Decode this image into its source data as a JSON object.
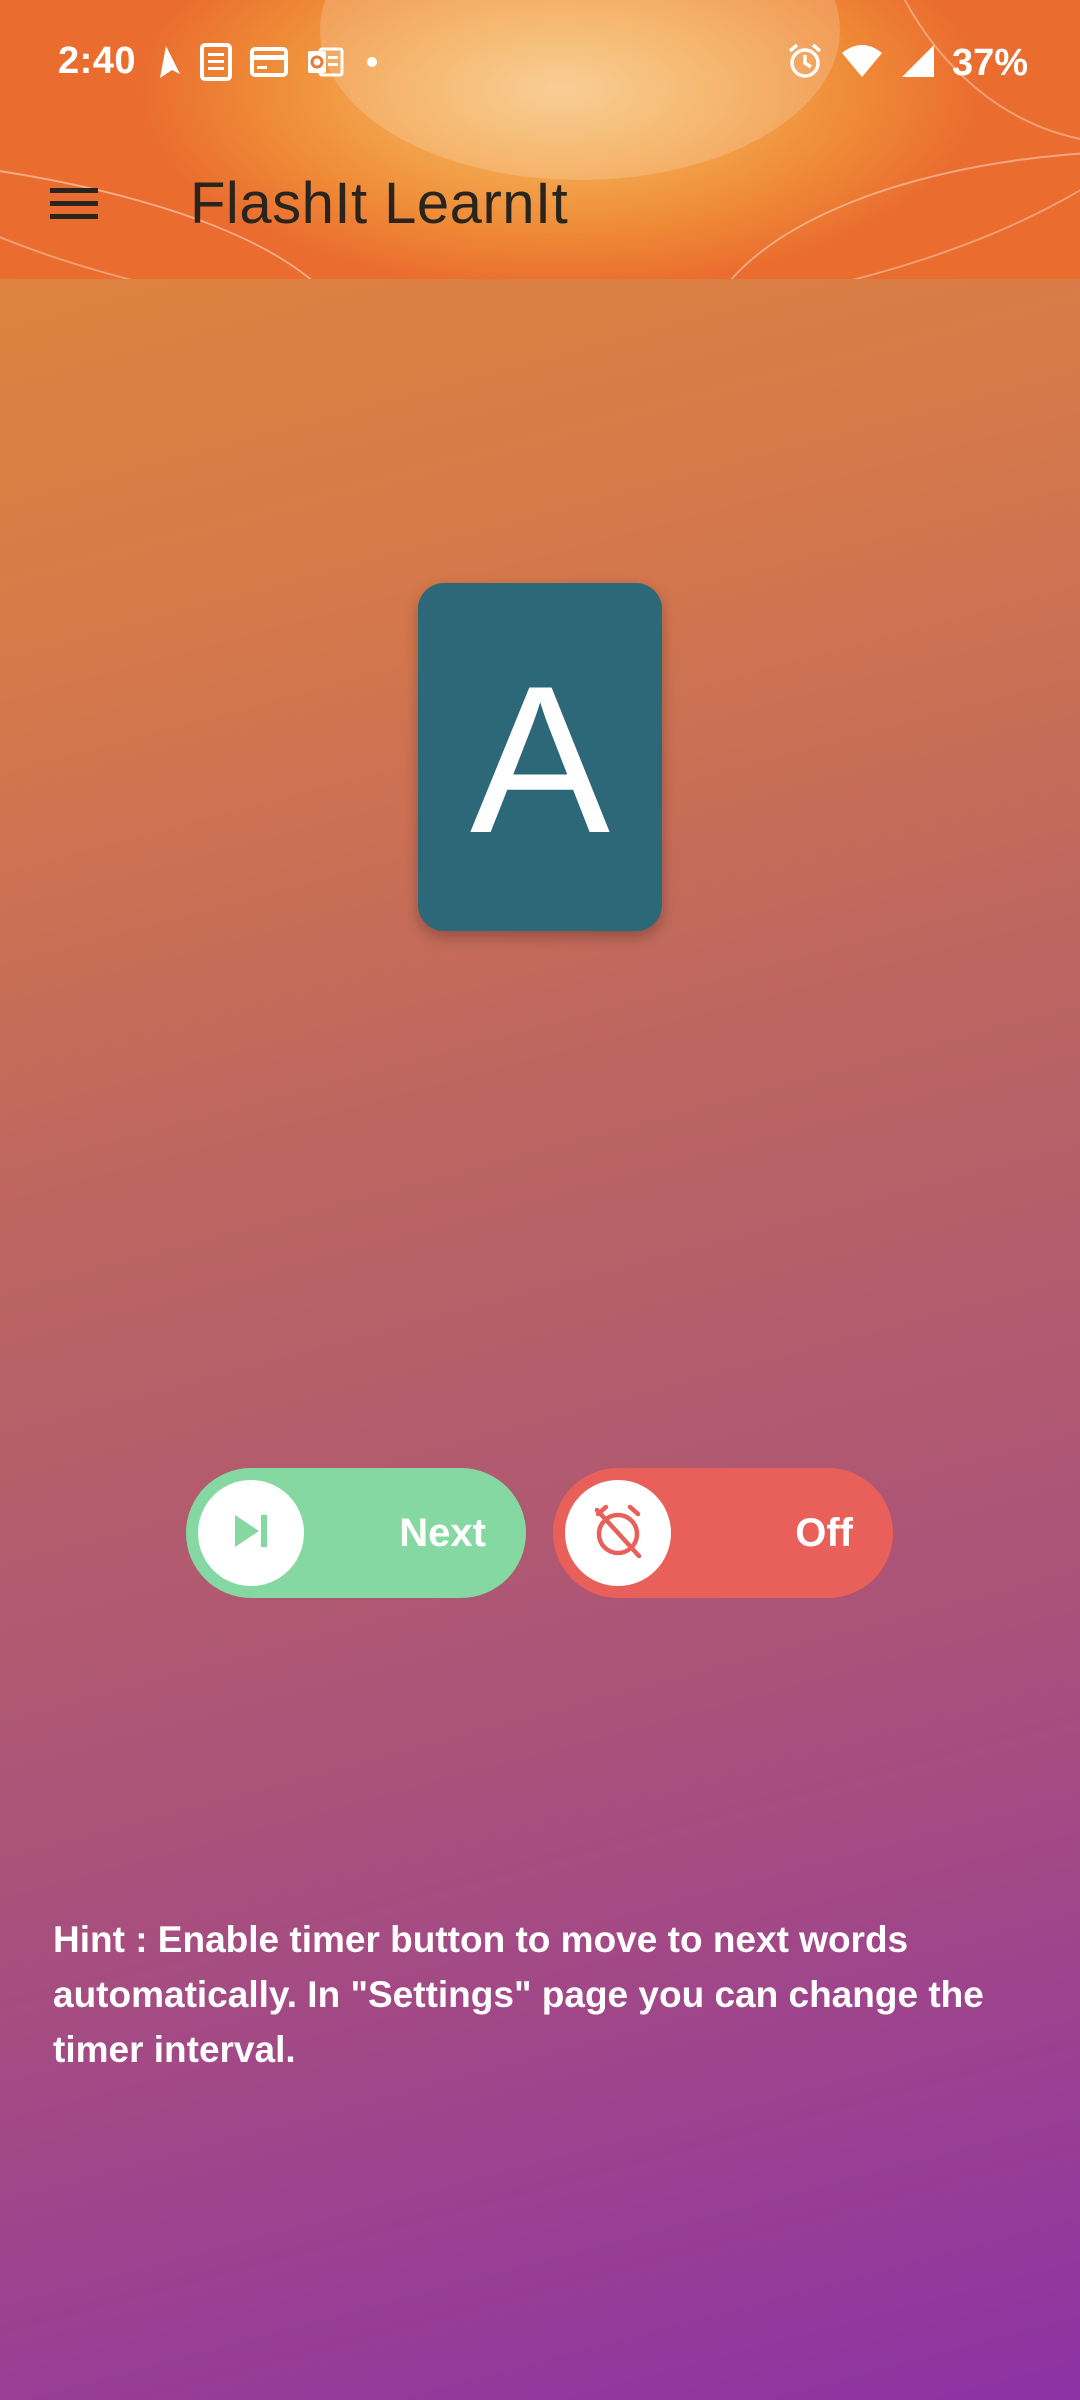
{
  "status_bar": {
    "time": "2:40",
    "battery": "37%",
    "left_icons": [
      "navigation-icon",
      "document-icon",
      "card-icon",
      "outlook-icon",
      "dot-icon"
    ],
    "right_icons": [
      "alarm-icon",
      "wifi-icon",
      "signal-icon"
    ]
  },
  "app_bar": {
    "title": "FlashIt LearnIt",
    "menu_icon": "menu-icon"
  },
  "flashcard": {
    "text": "A",
    "color": "#2d6878"
  },
  "controls": {
    "next": {
      "label": "Next",
      "icon": "skip-next-icon",
      "color": "#86d8a2"
    },
    "timer": {
      "label": "Off",
      "icon": "timer-off-icon",
      "color": "#e9605b"
    }
  },
  "hint": {
    "text": "Hint : Enable timer button to move to next words automatically. In \"Settings\" page you can change the timer interval."
  }
}
